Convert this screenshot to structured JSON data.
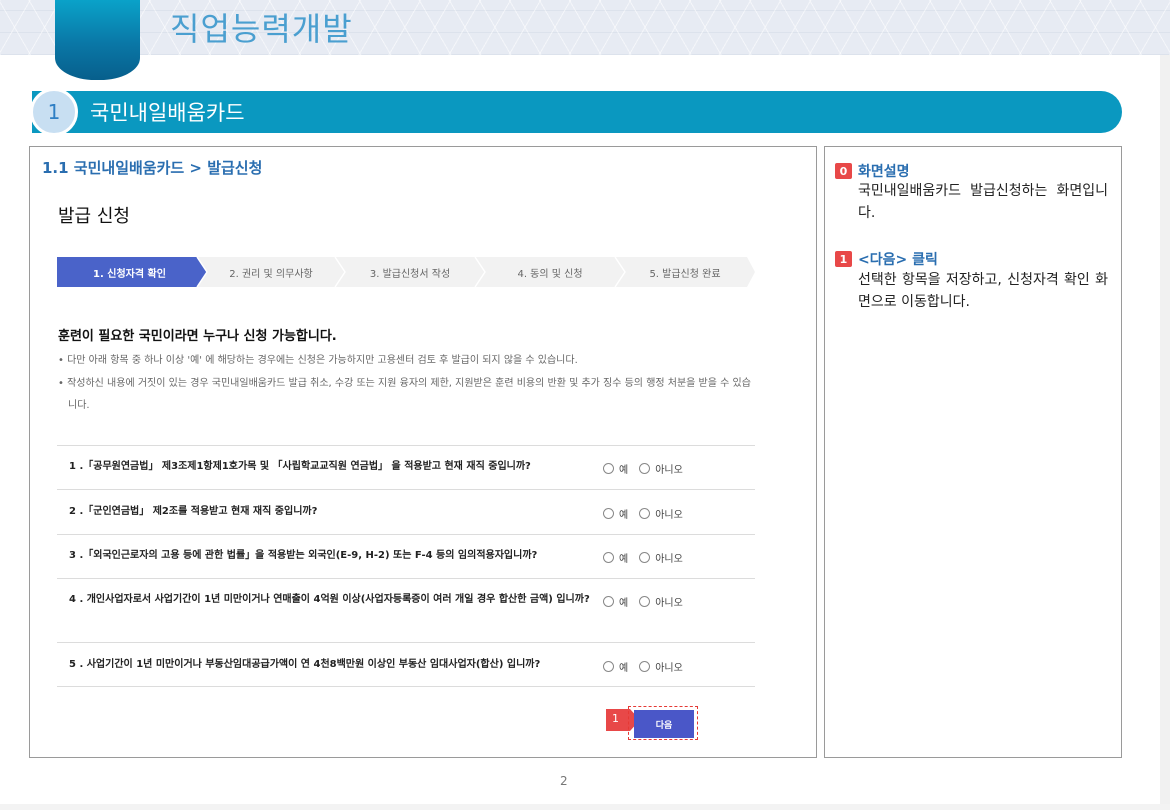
{
  "banner": {
    "title": "직업능력개발"
  },
  "section": {
    "number": "1",
    "title": "국민내일배움카드"
  },
  "left": {
    "breadcrumb": "1.1 국민내일배움카드 > 발급신청",
    "page_title": "발급 신청",
    "steps": [
      {
        "label": "1. 신청자격 확인",
        "active": true
      },
      {
        "label": "2. 권리 및 의무사항",
        "active": false
      },
      {
        "label": "3. 발급신청서 작성",
        "active": false
      },
      {
        "label": "4. 동의 및 신청",
        "active": false
      },
      {
        "label": "5. 발급신청 완료",
        "active": false
      }
    ],
    "intro_heading": "훈련이 필요한 국민이라면 누구나 신청 가능합니다.",
    "bullets": [
      "다만 아래 항목 중 하나 이상 '예' 에 해당하는 경우에는 신청은 가능하지만 고용센터 검토 후 발급이 되지 않을 수 있습니다.",
      "작성하신 내용에 거짓이 있는 경우 국민내일배움카드 발급 취소, 수강 또는 지원 융자의 제한, 지원받은 훈련 비용의 반환 및 추가 징수 등의 행정 처분을 받을 수 있습니다."
    ],
    "questions": [
      "1 .「공무원연금법」 제3조제1항제1호가목 및 「사립학교교직원 연금법」 을 적용받고 현재 재직 중입니까?",
      "2 .「군인연금법」 제2조를 적용받고 현재 재직 중입니까?",
      "3 .「외국인근로자의 고용 등에 관한 법률」을 적용받는 외국인(E-9, H-2) 또는 F-4 등의 임의적용자입니까?",
      "4 . 개인사업자로서 사업기간이 1년 미만이거나 연매출이 4억원 이상(사업자등록증이 여러 개일 경우 합산한 금액) 입니까?",
      "5 . 사업기간이 1년 미만이거나 부동산임대공급가액이 연 4천8백만원 이상인 부동산 임대사업자(합산) 입니까?"
    ],
    "option_yes": "예",
    "option_no": "아니오",
    "next_label": "다음",
    "marker_num": "1"
  },
  "right": {
    "items": [
      {
        "badge": "0",
        "title": "화면설명",
        "body": "국민내일배움카드  발급신청하는 화면입니다."
      },
      {
        "badge": "1",
        "title": "<다음> 클릭",
        "body": "선택한 항목을 저장하고, 신청자격 확인 화면으로 이동합니다."
      }
    ]
  },
  "page_number": "2",
  "colors": {
    "accent": "#0a98c0",
    "step_active": "#4a63c9",
    "next_button": "#4a57c8",
    "badge": "#e84848",
    "link": "#2a6eb0"
  }
}
